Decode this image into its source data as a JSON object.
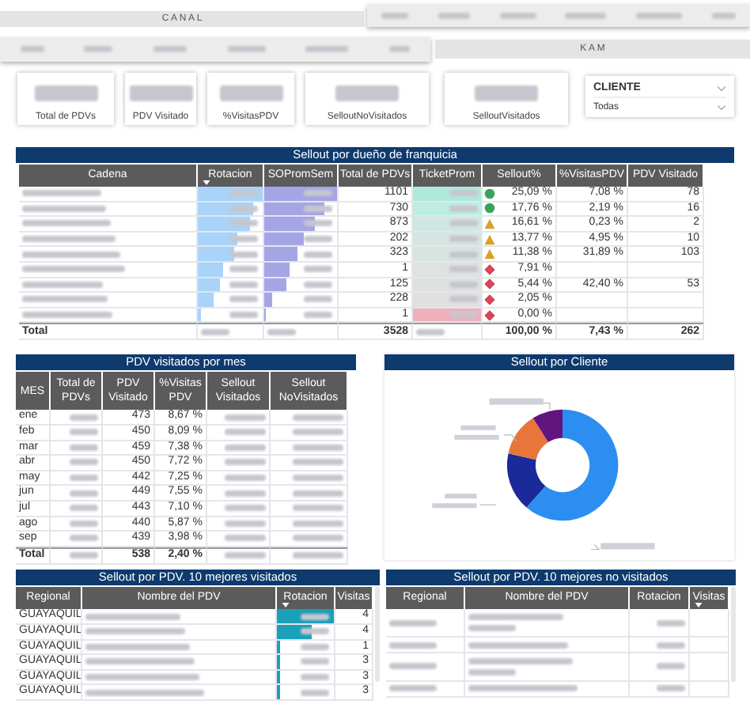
{
  "header": {
    "canal": "C A N A L",
    "kam": "K A M"
  },
  "cards": [
    {
      "label": "Total de PDVs"
    },
    {
      "label": "PDV Visitado"
    },
    {
      "label": "%VisitasPDV"
    },
    {
      "label": "SelloutNoVisitados"
    },
    {
      "label": "SelloutVisitados"
    }
  ],
  "filter": {
    "label": "CLIENTE",
    "value": "Todas"
  },
  "franchise_table": {
    "title": "Sellout por dueño de franquicia",
    "columns": [
      {
        "label": "Cadena",
        "sorted": false
      },
      {
        "label": "Rotacion",
        "sorted": true
      },
      {
        "label": "SOPromSem",
        "sorted": false
      },
      {
        "label": "Total de PDVs",
        "sorted": false
      },
      {
        "label": "TicketProm",
        "sorted": false
      },
      {
        "label": "Sellout%",
        "sorted": false
      },
      {
        "label": "%VisitasPDV",
        "sorted": false
      },
      {
        "label": "PDV Visitado",
        "sorted": false
      }
    ],
    "rows": [
      {
        "rotacion": {
          "level": 1.0
        },
        "sopromsem": {
          "level": 1.0
        },
        "total_pdvs": "1101",
        "ticket": {
          "color": "#aeeadb"
        },
        "indicator": {
          "kind": "circle"
        },
        "sellout": "25,09 %",
        "visitas": "7,08 %",
        "visitado": "78"
      },
      {
        "rotacion": {
          "level": 0.85
        },
        "sopromsem": {
          "level": 0.82
        },
        "total_pdvs": "730",
        "ticket": {
          "color": "#bdeee1"
        },
        "indicator": {
          "kind": "circle"
        },
        "sellout": "17,76 %",
        "visitas": "2,19 %",
        "visitado": "16"
      },
      {
        "rotacion": {
          "level": 0.8
        },
        "sopromsem": {
          "level": 0.7
        },
        "total_pdvs": "873",
        "ticket": {
          "color": "#d0e8e2"
        },
        "indicator": {
          "kind": "triangle"
        },
        "sellout": "16,61 %",
        "visitas": "0,23 %",
        "visitado": "2"
      },
      {
        "rotacion": {
          "level": 0.6
        },
        "sopromsem": {
          "level": 0.55
        },
        "total_pdvs": "202",
        "ticket": {
          "color": "#d5e5e1"
        },
        "indicator": {
          "kind": "triangle"
        },
        "sellout": "13,77 %",
        "visitas": "4,95 %",
        "visitado": "10"
      },
      {
        "rotacion": {
          "level": 0.55
        },
        "sopromsem": {
          "level": 0.45
        },
        "total_pdvs": "323",
        "ticket": {
          "color": "#d8e4e0"
        },
        "indicator": {
          "kind": "triangle"
        },
        "sellout": "11,38 %",
        "visitas": "31,89 %",
        "visitado": "103"
      },
      {
        "rotacion": {
          "level": 0.4
        },
        "sopromsem": {
          "level": 0.35
        },
        "total_pdvs": "1",
        "ticket": {
          "color": "#dce3e1"
        },
        "indicator": {
          "kind": "diamond"
        },
        "sellout": "7,91 %"
      },
      {
        "rotacion": {
          "level": 0.35
        },
        "sopromsem": {
          "level": 0.3
        },
        "total_pdvs": "125",
        "ticket": {
          "color": "#dde2e0"
        },
        "indicator": {
          "kind": "diamond"
        },
        "sellout": "5,44 %",
        "visitas": "42,40 %",
        "visitado": "53"
      },
      {
        "rotacion": {
          "level": 0.25
        },
        "sopromsem": {
          "level": 0.1
        },
        "total_pdvs": "228",
        "ticket": {
          "color": "#e0e0e0"
        },
        "indicator": {
          "kind": "diamond"
        },
        "sellout": "2,05 %"
      },
      {
        "rotacion": {
          "level": 0.05
        },
        "sopromsem": {
          "level": 0.03
        },
        "total_pdvs": "1",
        "ticket": {
          "color": "#f0b0b8"
        },
        "indicator": {
          "kind": "diamond"
        },
        "sellout": "0,00 %"
      }
    ],
    "total": {
      "label": "Total",
      "total_pdvs": "3528",
      "sellout": "100,00 %",
      "visitas": "7,43 %",
      "visitado": "262"
    }
  },
  "month_table": {
    "title": "PDV visitados por mes",
    "columns": [
      "MES",
      "Total de PDVs",
      "PDV Visitado",
      "%Visitas PDV",
      "Sellout Visitados",
      "Sellout NoVisitados"
    ],
    "rows": [
      {
        "mes": "ene",
        "visitado": "473",
        "pct": "8,67 %"
      },
      {
        "mes": "feb",
        "visitado": "450",
        "pct": "8,09 %"
      },
      {
        "mes": "mar",
        "visitado": "459",
        "pct": "7,38 %"
      },
      {
        "mes": "abr",
        "visitado": "450",
        "pct": "7,72 %"
      },
      {
        "mes": "may",
        "visitado": "442",
        "pct": "7,25 %"
      },
      {
        "mes": "jun",
        "visitado": "449",
        "pct": "7,55 %"
      },
      {
        "mes": "jul",
        "visitado": "443",
        "pct": "7,10 %"
      },
      {
        "mes": "ago",
        "visitado": "440",
        "pct": "5,87 %"
      },
      {
        "mes": "sep",
        "visitado": "439",
        "pct": "3,98 %"
      }
    ],
    "total": {
      "mes": "Total",
      "visitado": "538",
      "pct": "2,40 %"
    }
  },
  "client_chart": {
    "title": "Sellout por Cliente"
  },
  "visited_table": {
    "title": "Sellout por PDV. 10 mejores visitados",
    "columns": [
      {
        "label": "Regional",
        "sorted": false
      },
      {
        "label": "Nombre del PDV",
        "sorted": false
      },
      {
        "label": "Rotacion",
        "sorted": true
      },
      {
        "label": "Visitas",
        "sorted": false
      }
    ],
    "rows": [
      {
        "regional": "GUAYAQUIL",
        "rotacion": {
          "level": 1.0
        },
        "visitas": "4"
      },
      {
        "regional": "GUAYAQUIL",
        "rotacion": {
          "level": 0.6
        },
        "visitas": "4"
      },
      {
        "regional": "GUAYAQUIL",
        "rotacion": {
          "level": 0.05
        },
        "visitas": "1"
      },
      {
        "regional": "GUAYAQUIL",
        "rotacion": {
          "level": 0.05
        },
        "visitas": "3"
      },
      {
        "regional": "GUAYAQUIL",
        "rotacion": {
          "level": 0.05
        },
        "visitas": "3"
      },
      {
        "regional": "GUAYAQUIL",
        "rotacion": {
          "level": 0.05
        },
        "visitas": "3"
      }
    ]
  },
  "unvisited_table": {
    "title": "Sellout por PDV. 10 mejores no visitados",
    "columns": [
      {
        "label": "Regional",
        "sorted": false
      },
      {
        "label": "Nombre del PDV",
        "sorted": false
      },
      {
        "label": "Rotacion",
        "sorted": false
      },
      {
        "label": "Visitas",
        "sorted": true
      }
    ],
    "rows": [
      {
        "wrapped": true
      },
      {
        "wrapped": false
      },
      {
        "wrapped": true
      },
      {
        "wrapped": false
      }
    ]
  }
}
